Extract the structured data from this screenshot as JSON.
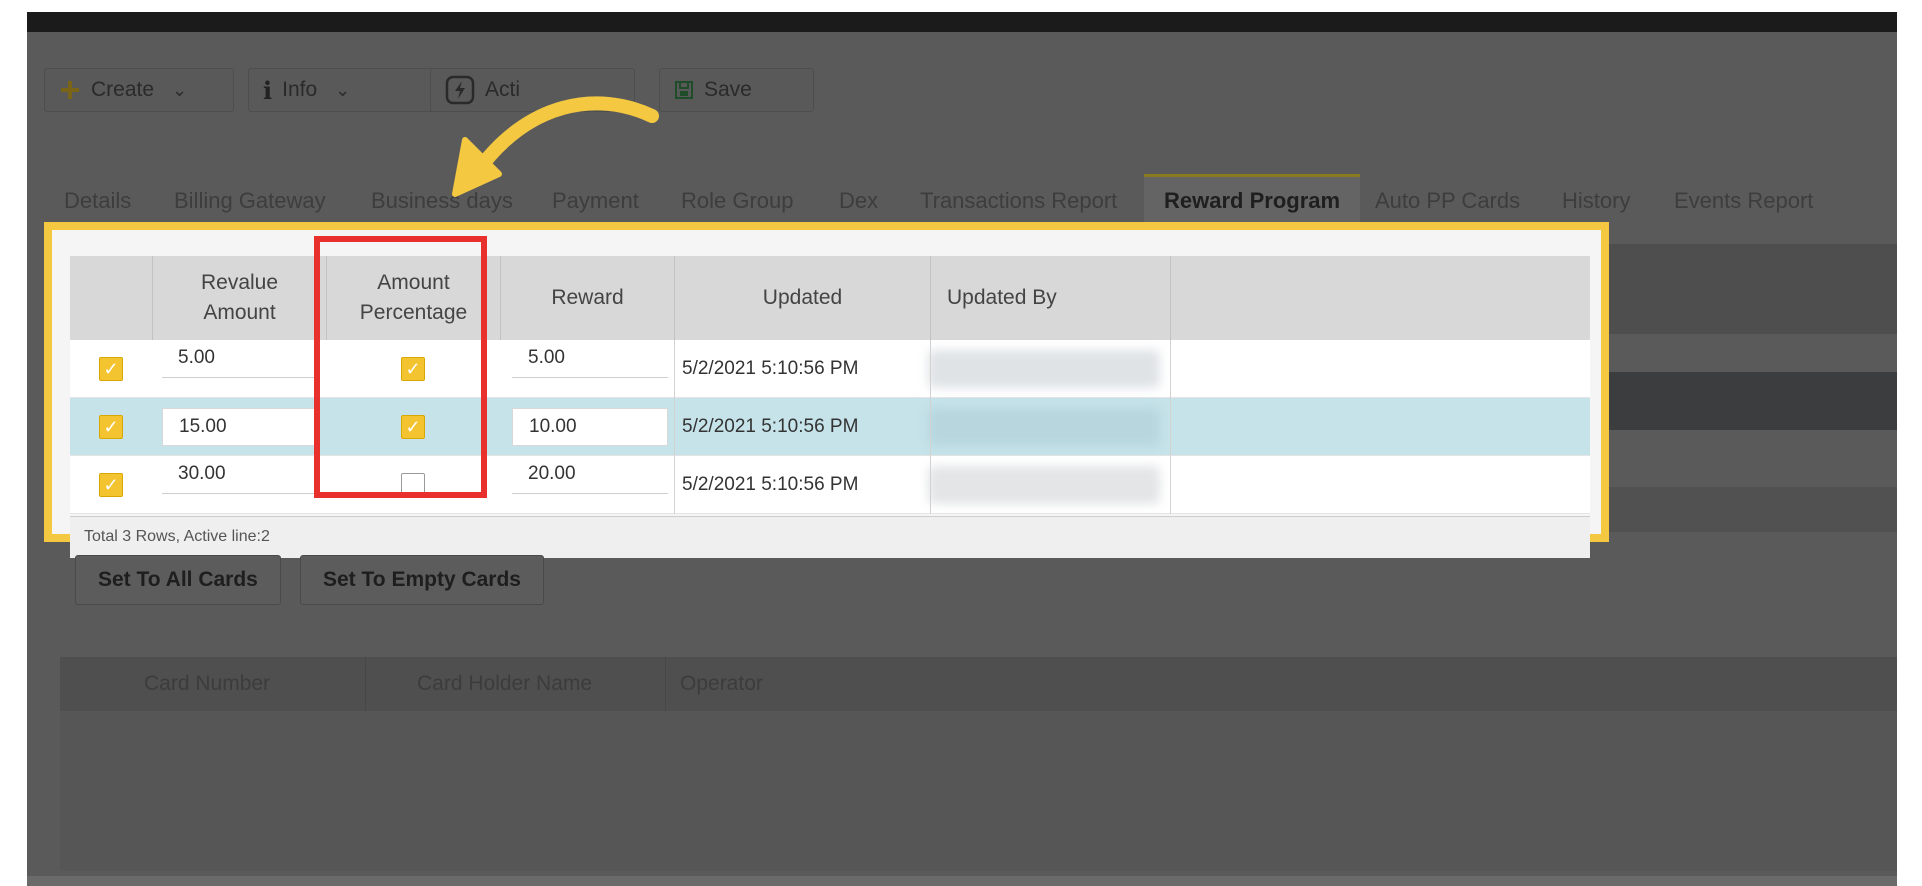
{
  "toolbar": {
    "create_label": "Create",
    "info_label": "Info",
    "actions_label": "Acti",
    "save_label": "Save"
  },
  "tabs": [
    {
      "label": "Details"
    },
    {
      "label": "Billing Gateway"
    },
    {
      "label": "Business days"
    },
    {
      "label": "Payment"
    },
    {
      "label": "Role Group"
    },
    {
      "label": "Dex"
    },
    {
      "label": "Transactions Report"
    },
    {
      "label": "Reward Program"
    },
    {
      "label": "Auto PP Cards"
    },
    {
      "label": "History"
    },
    {
      "label": "Events Report"
    }
  ],
  "active_tab": "Reward Program",
  "reward_grid": {
    "columns": {
      "revalue_amount": "Revalue\nAmount",
      "amount_percentage": "Amount\nPercentage",
      "reward": "Reward",
      "updated": "Updated",
      "updated_by": "Updated By"
    },
    "rows": [
      {
        "active": true,
        "revalue_amount": "5.00",
        "amount_percentage": true,
        "reward": "5.00",
        "updated": "5/2/2021 5:10:56 PM",
        "selected": false
      },
      {
        "active": true,
        "revalue_amount": "15.00",
        "amount_percentage": true,
        "reward": "10.00",
        "updated": "5/2/2021 5:10:56 PM",
        "selected": true
      },
      {
        "active": true,
        "revalue_amount": "30.00",
        "amount_percentage": false,
        "reward": "20.00",
        "updated": "5/2/2021 5:10:56 PM",
        "selected": false
      }
    ],
    "footer": "Total 3 Rows, Active line:2"
  },
  "buttons": {
    "set_all": "Set To All Cards",
    "set_empty": "Set To Empty Cards"
  },
  "cards_grid": {
    "columns": [
      "Card Number",
      "Card Holder Name",
      "Operator"
    ]
  },
  "colors": {
    "highlight_yellow": "#f5c842",
    "highlight_red": "#e8302d",
    "checkbox_yellow": "#f4c430",
    "active_row": "#c6e3ea",
    "overlay_gray": "#5a5a5a"
  }
}
